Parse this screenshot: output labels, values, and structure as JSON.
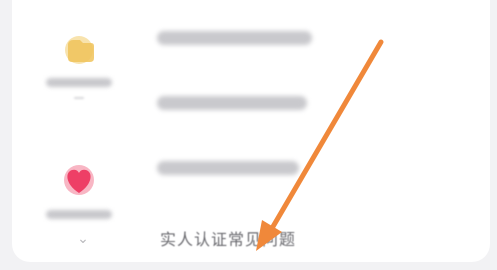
{
  "faq": {
    "question_4": "实人认证常见问题"
  }
}
